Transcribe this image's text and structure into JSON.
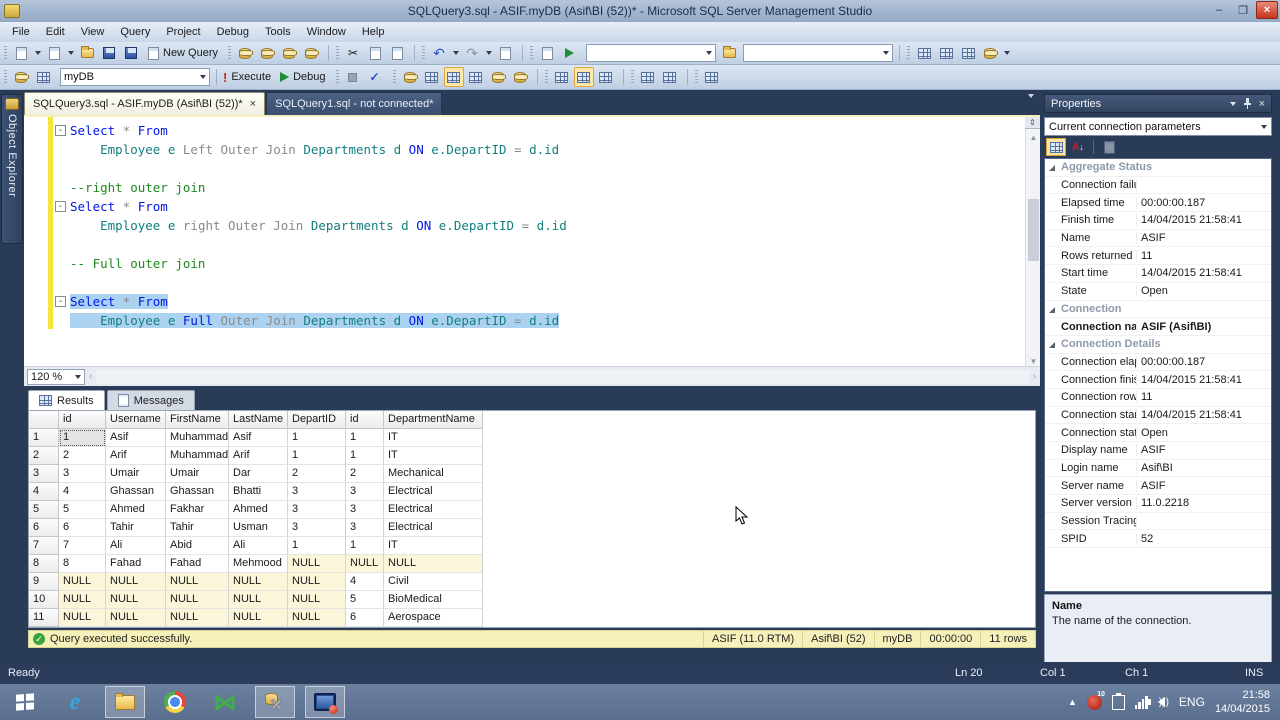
{
  "window": {
    "title": "SQLQuery3.sql - ASIF.myDB (Asif\\BI (52))* - Microsoft SQL Server Management Studio",
    "minimize": "–",
    "maximize": "❐",
    "close": "×"
  },
  "menu": {
    "items": [
      "File",
      "Edit",
      "View",
      "Query",
      "Project",
      "Debug",
      "Tools",
      "Window",
      "Help"
    ]
  },
  "toolbar1": {
    "icons_a": [
      "new-doc",
      "dropdown-caret",
      "add-item",
      "dropdown-caret",
      "open-folder",
      "save",
      "save-all"
    ],
    "new_query_label": "New Query",
    "icons_b": [
      "new-db-engine-query",
      "new-analysis-query",
      "new-mdx-query",
      "new-xmla-query"
    ],
    "icons_c": [
      "cut",
      "copy",
      "paste"
    ],
    "icons_d": [
      "undo",
      "dropdown-caret",
      "redo",
      "dropdown-caret",
      "navigate-backward"
    ],
    "icons_e": [
      "xml-editor",
      "run"
    ],
    "combo1": "",
    "combo2": "",
    "icons_f": [
      "find-in-files",
      "new-window",
      "tools-options",
      "activity-monitor",
      "dropdown-caret"
    ]
  },
  "toolbar2": {
    "icons_a": [
      "registered-servers",
      "change-connection"
    ],
    "db_combo": "myDB",
    "execute_label": "Execute",
    "debug_label": "Debug",
    "icons_b": [
      "stop",
      "parse-check"
    ],
    "icons_c": [
      "display-estimated-plan",
      "query-designer",
      "specify-template*",
      "analyze-query",
      "include-actual-plan",
      "client-statistics"
    ],
    "icons_d": [
      "results-to-text",
      "results-to-grid*",
      "results-to-file"
    ],
    "icons_e": [
      "indent-decrease",
      "indent-increase"
    ],
    "icons_f": [
      "comment-ab"
    ]
  },
  "object_explorer_label": "Object Explorer",
  "tabs": [
    {
      "label": "SQLQuery3.sql - ASIF.myDB (Asif\\BI (52))*",
      "active": true,
      "close": "×"
    },
    {
      "label": "SQLQuery1.sql - not connected*",
      "active": false
    }
  ],
  "editor": {
    "zoom": "120 %",
    "lines": [
      {
        "fold": "-",
        "segs": [
          {
            "c": "kw",
            "t": "Select"
          },
          {
            "c": "gray",
            "t": " * "
          },
          {
            "c": "kw",
            "t": "From"
          }
        ]
      },
      {
        "segs": [
          {
            "c": "id",
            "t": "    Employee e "
          },
          {
            "c": "gray",
            "t": "Left Outer Join "
          },
          {
            "c": "id",
            "t": "Departments d "
          },
          {
            "c": "kw",
            "t": "ON"
          },
          {
            "c": "id",
            "t": " e.DepartID "
          },
          {
            "c": "gray",
            "t": "= "
          },
          {
            "c": "id",
            "t": "d.id"
          }
        ]
      },
      {
        "segs": []
      },
      {
        "segs": [
          {
            "c": "com",
            "t": "--right outer join"
          }
        ]
      },
      {
        "fold": "-",
        "segs": [
          {
            "c": "kw",
            "t": "Select"
          },
          {
            "c": "gray",
            "t": " * "
          },
          {
            "c": "kw",
            "t": "From"
          }
        ]
      },
      {
        "segs": [
          {
            "c": "id",
            "t": "    Employee e "
          },
          {
            "c": "gray",
            "t": "right Outer Join "
          },
          {
            "c": "id",
            "t": "Departments d "
          },
          {
            "c": "kw",
            "t": "ON"
          },
          {
            "c": "id",
            "t": " e.DepartID "
          },
          {
            "c": "gray",
            "t": "= "
          },
          {
            "c": "id",
            "t": "d.id"
          }
        ]
      },
      {
        "segs": []
      },
      {
        "segs": [
          {
            "c": "com",
            "t": "-- Full outer join"
          }
        ]
      },
      {
        "segs": []
      },
      {
        "fold": "-",
        "sel": true,
        "segs": [
          {
            "c": "kw",
            "t": "Select"
          },
          {
            "c": "gray",
            "t": " * "
          },
          {
            "c": "kw",
            "t": "From"
          }
        ]
      },
      {
        "sel": true,
        "segs": [
          {
            "c": "id",
            "t": "    Employee e "
          },
          {
            "c": "kw",
            "t": "Full"
          },
          {
            "c": "gray",
            "t": " Outer Join "
          },
          {
            "c": "id",
            "t": "Departments d "
          },
          {
            "c": "kw",
            "t": "ON"
          },
          {
            "c": "id",
            "t": " e.DepartID "
          },
          {
            "c": "gray",
            "t": "= "
          },
          {
            "c": "id",
            "t": "d.id"
          }
        ]
      }
    ]
  },
  "results": {
    "tabs": [
      {
        "label": "Results",
        "active": true
      },
      {
        "label": "Messages",
        "active": false
      }
    ],
    "columns": [
      "",
      "id",
      "Username",
      "FirstName",
      "LastName",
      "DepartID",
      "id",
      "DepartmentName"
    ],
    "rows": [
      [
        "1",
        "Asif",
        "Muhammad",
        "Asif",
        "1",
        "1",
        "IT"
      ],
      [
        "2",
        "Arif",
        "Muhammad",
        "Arif",
        "1",
        "1",
        "IT"
      ],
      [
        "3",
        "Umair",
        "Umair",
        "Dar",
        "2",
        "2",
        "Mechanical"
      ],
      [
        "4",
        "Ghassan",
        "Ghassan",
        "Bhatti",
        "3",
        "3",
        "Electrical"
      ],
      [
        "5",
        "Ahmed",
        "Fakhar",
        "Ahmed",
        "3",
        "3",
        "Electrical"
      ],
      [
        "6",
        "Tahir",
        "Tahir",
        "Usman",
        "3",
        "3",
        "Electrical"
      ],
      [
        "7",
        "Ali",
        "Abid",
        "Ali",
        "1",
        "1",
        "IT"
      ],
      [
        "8",
        "Fahad",
        "Fahad",
        "Mehmood",
        "NULL",
        "NULL",
        "NULL"
      ],
      [
        "NULL",
        "NULL",
        "NULL",
        "NULL",
        "NULL",
        "4",
        "Civil"
      ],
      [
        "NULL",
        "NULL",
        "NULL",
        "NULL",
        "NULL",
        "5",
        "BioMedical"
      ],
      [
        "NULL",
        "NULL",
        "NULL",
        "NULL",
        "NULL",
        "6",
        "Aerospace"
      ]
    ],
    "status": {
      "message": "Query executed successfully.",
      "check": "✓",
      "server": "ASIF (11.0 RTM)",
      "login": "Asif\\BI (52)",
      "database": "myDB",
      "time": "00:00:00",
      "rowcount": "11 rows"
    }
  },
  "properties": {
    "title": "Properties",
    "combo": "Current connection parameters",
    "rows": [
      {
        "type": "cat",
        "label": "Aggregate Status"
      },
      {
        "type": "prop",
        "label": "Connection failures",
        "value": ""
      },
      {
        "type": "prop",
        "label": "Elapsed time",
        "value": "00:00:00.187"
      },
      {
        "type": "prop",
        "label": "Finish time",
        "value": "14/04/2015 21:58:41"
      },
      {
        "type": "prop",
        "label": "Name",
        "value": "ASIF"
      },
      {
        "type": "prop",
        "label": "Rows returned",
        "value": "11"
      },
      {
        "type": "prop",
        "label": "Start time",
        "value": "14/04/2015 21:58:41"
      },
      {
        "type": "prop",
        "label": "State",
        "value": "Open"
      },
      {
        "type": "cat",
        "label": "Connection"
      },
      {
        "type": "prop",
        "label": "Connection name",
        "value": "ASIF (Asif\\BI)",
        "sel": true
      },
      {
        "type": "cat",
        "label": "Connection Details"
      },
      {
        "type": "prop",
        "label": "Connection elapsed time",
        "value": "00:00:00.187"
      },
      {
        "type": "prop",
        "label": "Connection finish time",
        "value": "14/04/2015 21:58:41"
      },
      {
        "type": "prop",
        "label": "Connection rows returned",
        "value": "11"
      },
      {
        "type": "prop",
        "label": "Connection start time",
        "value": "14/04/2015 21:58:41"
      },
      {
        "type": "prop",
        "label": "Connection state",
        "value": "Open"
      },
      {
        "type": "prop",
        "label": "Display name",
        "value": "ASIF"
      },
      {
        "type": "prop",
        "label": "Login name",
        "value": "Asif\\BI"
      },
      {
        "type": "prop",
        "label": "Server name",
        "value": "ASIF"
      },
      {
        "type": "prop",
        "label": "Server version",
        "value": "11.0.2218"
      },
      {
        "type": "prop",
        "label": "Session Tracing ID",
        "value": ""
      },
      {
        "type": "prop",
        "label": "SPID",
        "value": "52"
      }
    ],
    "description": {
      "title": "Name",
      "text": "The name of the connection."
    }
  },
  "statusbar": {
    "ready": "Ready",
    "ln": "Ln 20",
    "col": "Col 1",
    "ch": "Ch 1",
    "ins": "INS"
  },
  "taskbar": {
    "lang": "ENG",
    "time": "21:58",
    "date": "14/04/2015",
    "badge": "10"
  }
}
